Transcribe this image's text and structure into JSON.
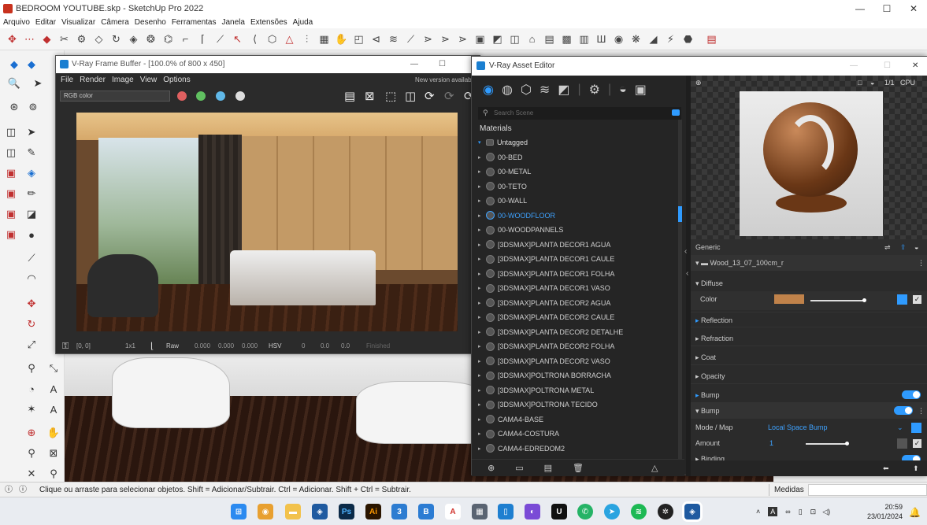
{
  "window": {
    "title": "BEDROOM YOUTUBE.skp - SketchUp Pro 2022",
    "minimize": "—",
    "maximize": "☐",
    "close": "✕"
  },
  "menu": [
    "Arquivo",
    "Editar",
    "Visualizar",
    "Câmera",
    "Desenho",
    "Ferramentas",
    "Janela",
    "Extensões",
    "Ajuda"
  ],
  "frame_buffer": {
    "title": "V-Ray Frame Buffer - [100.0% of 800 x 450]",
    "menu": [
      "File",
      "Render",
      "Image",
      "View",
      "Options"
    ],
    "notice": "New version availabl",
    "channel": "RGB color",
    "status": {
      "coords": "[0, 0]",
      "format": "1x1",
      "raw": "Raw",
      "r": "0.000",
      "g": "0.000",
      "b": "0.000",
      "mode": "HSV",
      "h": "0",
      "s": "0.0",
      "v": "0.0",
      "state": "Finished"
    }
  },
  "asset_editor": {
    "title": "V-Ray Asset Editor",
    "search_placeholder": "Search Scene",
    "section": "Materials",
    "materials": [
      {
        "name": "Untagged",
        "type": "group"
      },
      {
        "name": "00-BED"
      },
      {
        "name": "00-METAL"
      },
      {
        "name": "00-TETO"
      },
      {
        "name": "00-WALL"
      },
      {
        "name": "00-WOODFLOOR",
        "selected": true
      },
      {
        "name": "00-WOODPANNELS"
      },
      {
        "name": "[3DSMAX]PLANTA DECOR1 AGUA"
      },
      {
        "name": "[3DSMAX]PLANTA DECOR1 CAULE"
      },
      {
        "name": "[3DSMAX]PLANTA DECOR1 FOLHA"
      },
      {
        "name": "[3DSMAX]PLANTA DECOR1 VASO"
      },
      {
        "name": "[3DSMAX]PLANTA DECOR2 AGUA"
      },
      {
        "name": "[3DSMAX]PLANTA DECOR2 CAULE"
      },
      {
        "name": "[3DSMAX]PLANTA DECOR2 DETALHE"
      },
      {
        "name": "[3DSMAX]PLANTA DECOR2 FOLHA"
      },
      {
        "name": "[3DSMAX]PLANTA DECOR2 VASO"
      },
      {
        "name": "[3DSMAX]POLTRONA BORRACHA"
      },
      {
        "name": "[3DSMAX]POLTRONA METAL"
      },
      {
        "name": "[3DSMAX]POLTRONA TECIDO"
      },
      {
        "name": "CAMA4-BASE"
      },
      {
        "name": "CAMA4-COSTURA"
      },
      {
        "name": "CAMA4-EDREDOM2"
      }
    ],
    "preview_ctl": "CPU",
    "preview_ratio": "1/1",
    "props": {
      "generic": "Generic",
      "layer": "Wood_13_07_100cm_r",
      "diffuse": "Diffuse",
      "color": "Color",
      "diffuse_color": "#c0824a",
      "reflection": "Reflection",
      "refraction": "Refraction",
      "coat": "Coat",
      "opacity": "Opacity",
      "bump": "Bump",
      "bump2": "Bump",
      "mode_label": "Mode / Map",
      "mode_value": "Local Space Bump",
      "amount_label": "Amount",
      "amount_value": "1",
      "binding": "Binding"
    }
  },
  "statusbar": {
    "hint": "Clique ou arraste para selecionar objetos. Shift = Adicionar/Subtrair. Ctrl = Adicionar. Shift + Ctrl = Subtrair.",
    "measure": "Medidas"
  },
  "taskbar": {
    "time": "20:59",
    "date": "23/01/2024"
  }
}
